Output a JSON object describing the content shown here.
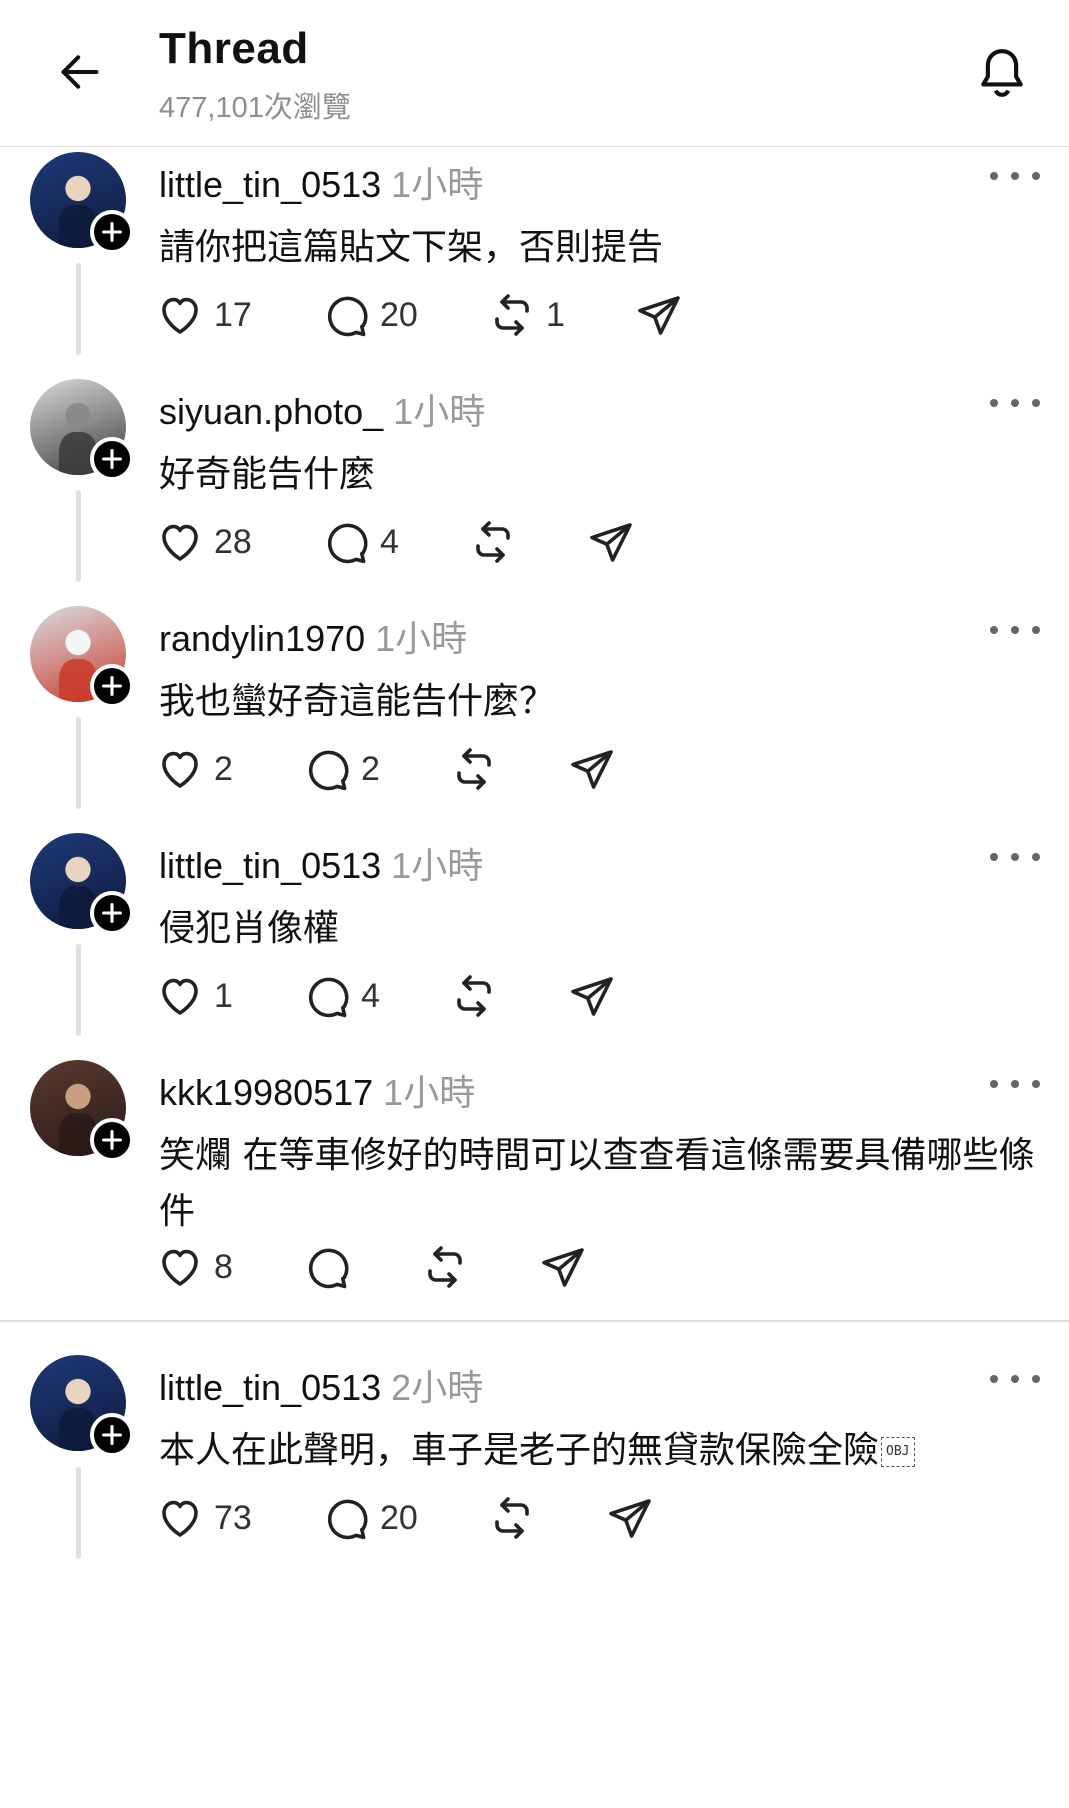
{
  "header": {
    "title": "Thread",
    "views": "477,101次瀏覽"
  },
  "posts": [
    {
      "username": "little_tin_0513",
      "time": "1小時",
      "text": "請你把這篇貼文下架，否則提告",
      "likes": "17",
      "replies": "20",
      "reposts": "1",
      "avatar_colors": [
        "#1f3a7a",
        "#0e1a3a",
        "#e8d5c0"
      ]
    },
    {
      "username": "siyuan.photo_",
      "time": "1小時",
      "text": "好奇能告什麼",
      "likes": "28",
      "replies": "4",
      "reposts": "",
      "avatar_colors": [
        "#d9d9d9",
        "#3a3a3a",
        "#8a8a8a"
      ]
    },
    {
      "username": "randylin1970",
      "time": "1小時",
      "text": "我也蠻好奇這能告什麼？",
      "likes": "2",
      "replies": "2",
      "reposts": "",
      "avatar_colors": [
        "#d8dde3",
        "#c93a2a",
        "#f5f5f5"
      ]
    },
    {
      "username": "little_tin_0513",
      "time": "1小時",
      "text": "侵犯肖像權",
      "likes": "1",
      "replies": "4",
      "reposts": "",
      "avatar_colors": [
        "#1f3a7a",
        "#0e1a3a",
        "#e8d5c0"
      ]
    },
    {
      "username": "kkk19980517",
      "time": "1小時",
      "text": "笑爛 在等車修好的時間可以查查看這條需要具備哪些條件",
      "likes": "8",
      "replies": "",
      "reposts": "",
      "avatar_colors": [
        "#5a3a30",
        "#2a1a18",
        "#c9a080"
      ]
    },
    {
      "username": "little_tin_0513",
      "time": "2小時",
      "text": "本人在此聲明，車子是老子的無貸款保險全險",
      "obj_glyph": "OBJ",
      "likes": "73",
      "replies": "20",
      "reposts": "",
      "avatar_colors": [
        "#1f3a7a",
        "#0e1a3a",
        "#e8d5c0"
      ]
    }
  ],
  "icons": {
    "back": "arrow-left-icon",
    "bell": "bell-icon",
    "like": "heart-icon",
    "reply": "comment-icon",
    "repost": "repost-icon",
    "share": "send-icon",
    "more": "more-icon",
    "follow": "plus-icon"
  },
  "colors": {
    "text": "#111111",
    "muted": "#999999",
    "divider": "#dcdcdc"
  }
}
